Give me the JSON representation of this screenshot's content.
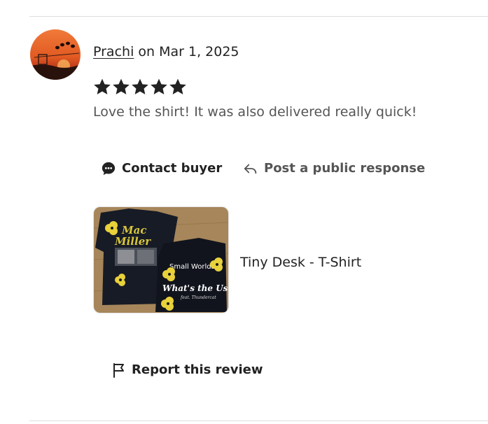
{
  "review": {
    "reviewer_name": "Prachi",
    "date_prefix": " on ",
    "date": "Mar 1, 2025",
    "rating": 5,
    "rating_max": 5,
    "text": "Love the shirt! It was also delivered really quick!"
  },
  "actions": {
    "contact_buyer": "Contact buyer",
    "post_response": "Post a public response",
    "report": "Report this review"
  },
  "product": {
    "name": "Tiny Desk - T-Shirt",
    "image_text": {
      "front_line1": "Mac",
      "front_line2": "Miller",
      "back_line1": "Small Worlds",
      "back_line2": "What's the Use",
      "back_line3": "feat. Thundercat"
    }
  },
  "icons": {
    "contact": "chat-bubble-icon",
    "respond": "reply-arrow-icon",
    "report": "flag-icon",
    "star": "star-icon"
  },
  "colors": {
    "text_primary": "#222222",
    "text_secondary": "#555555",
    "star": "#222222",
    "divider": "#dddddd"
  }
}
